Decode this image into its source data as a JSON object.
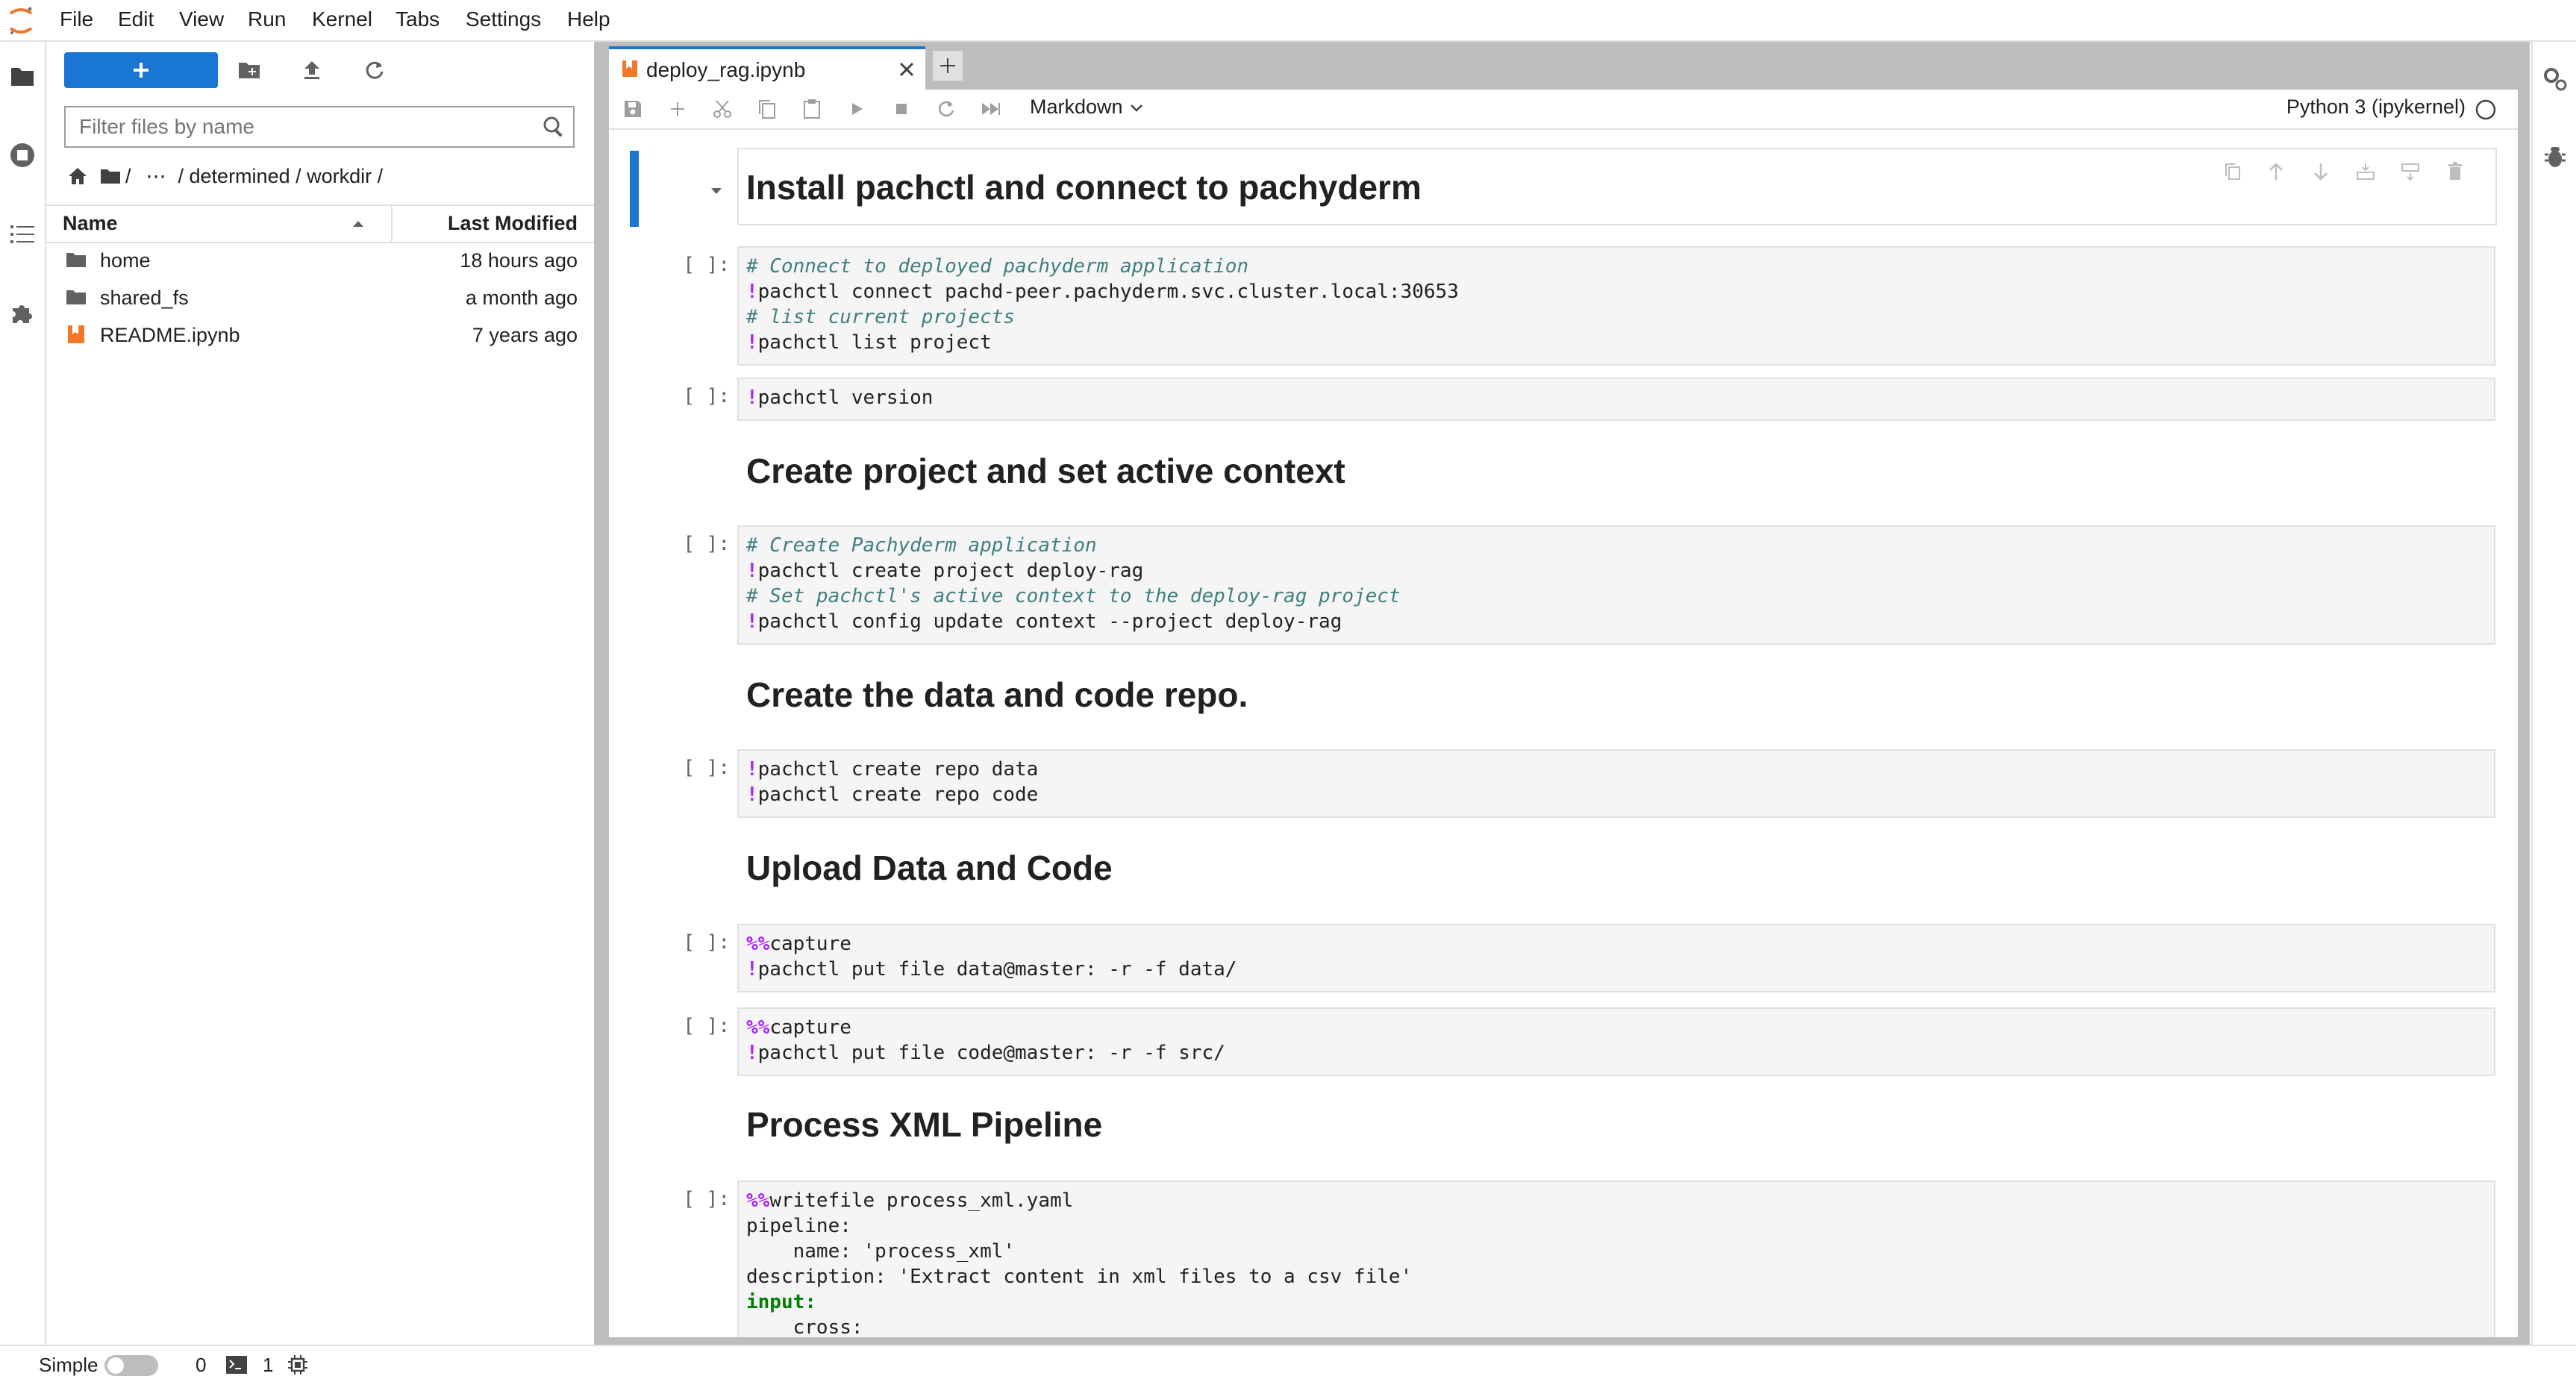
{
  "menubar": {
    "items": [
      "File",
      "Edit",
      "View",
      "Run",
      "Kernel",
      "Tabs",
      "Settings",
      "Help"
    ]
  },
  "filebrowser": {
    "filter_placeholder": "Filter files by name",
    "breadcrumb": [
      "/",
      "⋯",
      "/ determined / workdir /"
    ],
    "columns": {
      "name": "Name",
      "modified": "Last Modified"
    },
    "files": [
      {
        "name": "home",
        "modified": "18 hours ago",
        "type": "folder"
      },
      {
        "name": "shared_fs",
        "modified": "a month ago",
        "type": "folder"
      },
      {
        "name": "README.ipynb",
        "modified": "7 years ago",
        "type": "notebook"
      }
    ]
  },
  "tab": {
    "title": "deploy_rag.ipynb"
  },
  "toolbar": {
    "cell_type": "Markdown",
    "kernel": "Python 3 (ipykernel)"
  },
  "cells": [
    {
      "kind": "markdown",
      "text": "Install pachctl and connect to pachyderm"
    },
    {
      "kind": "code",
      "prompt": "[ ]:"
    },
    {
      "kind": "code",
      "prompt": "[ ]:"
    },
    {
      "kind": "markdown",
      "text": "Create project and set active context"
    },
    {
      "kind": "code",
      "prompt": "[ ]:"
    },
    {
      "kind": "markdown",
      "text": "Create the data and code repo."
    },
    {
      "kind": "code",
      "prompt": "[ ]:"
    },
    {
      "kind": "markdown",
      "text": "Upload Data and Code"
    },
    {
      "kind": "code",
      "prompt": "[ ]:"
    },
    {
      "kind": "code",
      "prompt": "[ ]:"
    },
    {
      "kind": "markdown",
      "text": "Process XML Pipeline"
    },
    {
      "kind": "code",
      "prompt": "[ ]:"
    }
  ],
  "code": {
    "c1": [
      "# Connect to deployed pachyderm application",
      "!pachctl connect pachd-peer.pachyderm.svc.cluster.local:30653",
      "# list current projects",
      "!pachctl list project"
    ],
    "c2": [
      "!pachctl version"
    ],
    "c3": [
      "# Create Pachyderm application",
      "!pachctl create project deploy-rag",
      "# Set pachctl's active context to the deploy-rag project",
      "!pachctl config update context --project deploy-rag"
    ],
    "c4": [
      "!pachctl create repo data",
      "!pachctl create repo code"
    ],
    "c5": [
      "%%capture",
      "!pachctl put file data@master: -r -f data/"
    ],
    "c6": [
      "%%capture",
      "!pachctl put file code@master: -r -f src/"
    ],
    "c7": [
      "%%writefile process_xml.yaml",
      "pipeline:",
      "    name: 'process_xml'",
      "description: 'Extract content in xml files to a csv file'",
      "input:",
      "    cross:"
    ]
  },
  "statusbar": {
    "mode_label": "Simple",
    "terminals": "0",
    "kernels": "1"
  },
  "colors": {
    "accent": "#1976d2",
    "notebook_icon": "#f37726",
    "comment": "#3f7f7f",
    "operator": "#aa22ff",
    "string": "#ba2121"
  }
}
